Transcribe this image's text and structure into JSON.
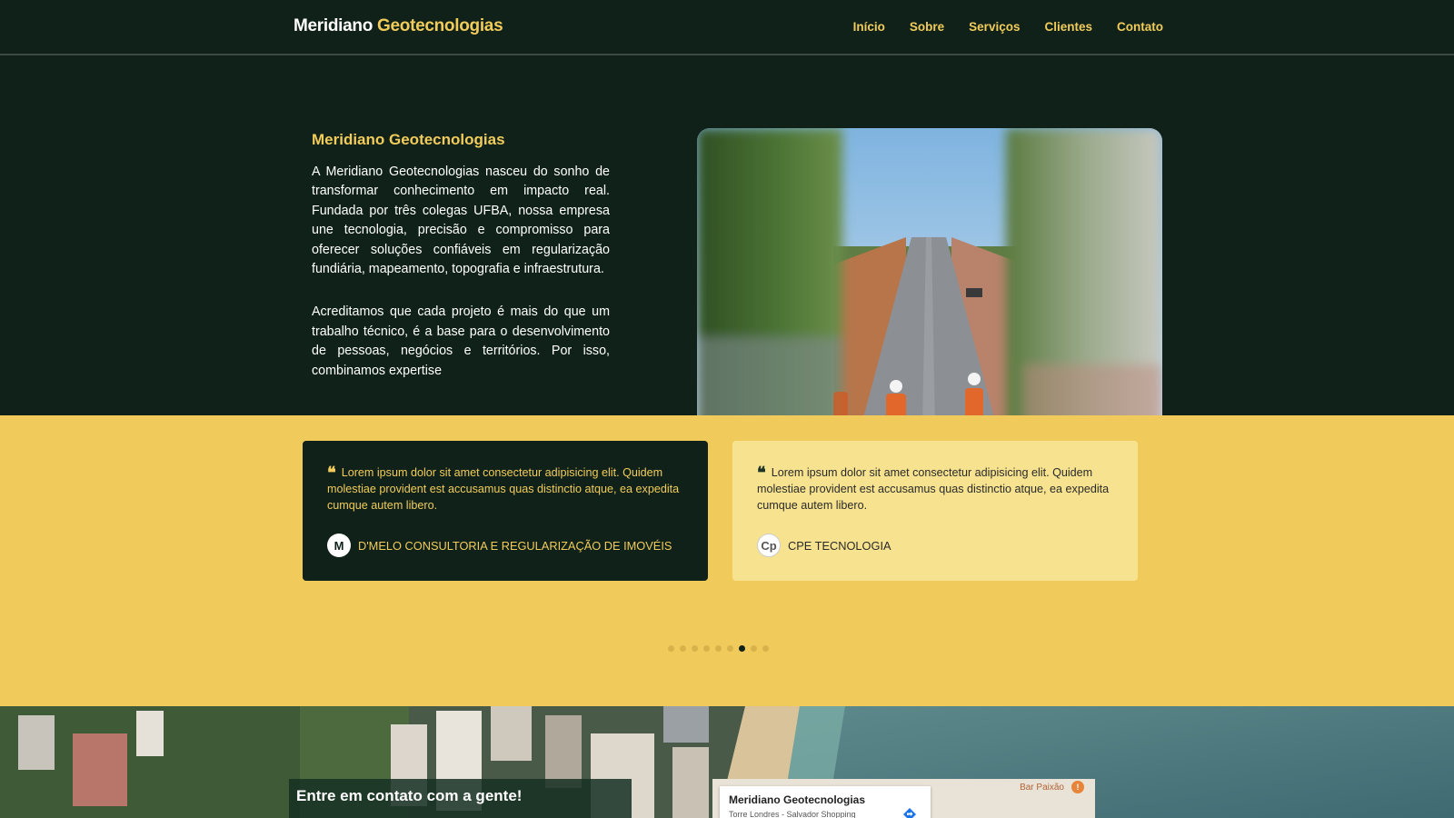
{
  "header": {
    "brand_part1": "Meridiano",
    "brand_part2": "Geotecnologias",
    "nav": [
      {
        "label": "Início"
      },
      {
        "label": "Sobre"
      },
      {
        "label": "Serviços"
      },
      {
        "label": "Clientes"
      },
      {
        "label": "Contato"
      }
    ]
  },
  "hero": {
    "title": "Meridiano Geotecnologias",
    "paragraph1": "A Meridiano Geotecnologias nasceu do sonho de transformar conhecimento em impacto real. Fundada por três colegas UFBA, nossa empresa une tecnologia, precisão e compromisso para oferecer soluções confiáveis em regularização fundiária, mapeamento, topografia e infraestrutura.",
    "paragraph2": "Acreditamos que cada projeto é mais do que um trabalho técnico, é a base para o desenvolvimento de pessoas, negócios e territórios. Por isso, combinamos expertise"
  },
  "testimonials": {
    "cards": [
      {
        "quote_icon": "quote-icon",
        "text": "Lorem ipsum dolor sit amet consectetur adipisicing elit. Quidem molestiae provident est accusamus quas distinctio atque, ea expedita cumque autem libero.",
        "company": "D'MELO CONSULTORIA E REGULARIZAÇÃO DE IMOVÉIS",
        "logo_letter": "M"
      },
      {
        "quote_icon": "quote-icon",
        "text": "Lorem ipsum dolor sit amet consectetur adipisicing elit. Quidem molestiae provident est accusamus quas distinctio atque, ea expedita cumque autem libero.",
        "company": "CPE TECNOLOGIA",
        "logo_letter": "Cp"
      }
    ],
    "dots_count": 9,
    "active_dot": 6
  },
  "contact": {
    "title": "Entre em contato com a gente!",
    "map": {
      "place_name": "Meridiano Geotecnologias",
      "address": "Torre Londres - Salvador Shopping",
      "nearby": "Bar Paixão"
    }
  },
  "colors": {
    "dark_green": "#0f2119",
    "accent_yellow": "#f2cc5b",
    "section_yellow": "#f0cb5c",
    "card_light": "#f7e38f"
  }
}
